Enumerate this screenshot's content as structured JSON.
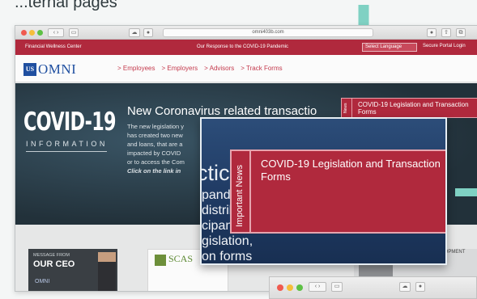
{
  "page_heading_fragment": "...ternal pages",
  "browser": {
    "url": "omni403b.com",
    "topnav": {
      "left": "Financial Wellness Center",
      "center": "Our Response to the COVID-19 Pandemic",
      "language": "Select Language",
      "portal": "Secure Portal Login"
    },
    "logo": {
      "box": "US",
      "text": "OMNI"
    },
    "nav": [
      "> Employees",
      "> Employers",
      "> Advisors",
      "> Track Forms"
    ]
  },
  "hero": {
    "covid_title": "COVID-19",
    "covid_sub": "INFORMATION",
    "heading": "New Coronavirus related transactio",
    "body_lines": [
      "The new legislation y",
      "has created two new",
      "and loans, that are a",
      "impacted by COVID",
      "or to access the Com"
    ],
    "link_line": "Click on the link in",
    "news_tag": "News",
    "news_title": "COVID-19 Legislation and Transaction Forms"
  },
  "lower": {
    "ceo_msg": "MESSAGE FROM",
    "ceo_big": "OUR CEO",
    "ceo_logo": "OMNI",
    "scas": "SCAS",
    "biz_text": "BUSINESS DEVELOPMENT MANAGER"
  },
  "magnifier": {
    "word": "ctic",
    "lines": [
      "pand",
      "distrib",
      "cipants",
      "gislation,",
      "on forms"
    ],
    "tag": "Important News",
    "title": "COVID-19 Legislation and Transaction Forms"
  },
  "colors": {
    "brand_red": "#b0293d",
    "brand_blue": "#1f4fa0",
    "teal_arrow": "#7fd1c3"
  }
}
